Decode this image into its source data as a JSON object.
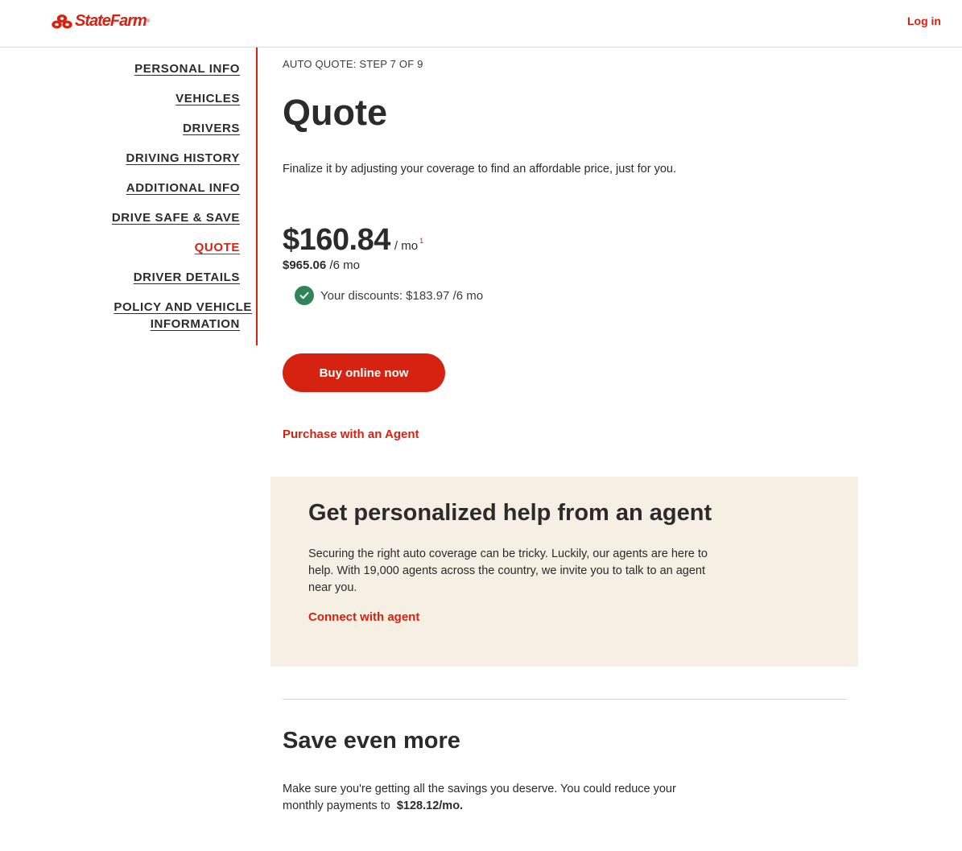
{
  "header": {
    "logo_text": "StateFarm",
    "logo_reg": "®",
    "login_label": "Log in"
  },
  "nav": {
    "items": [
      {
        "label": "PERSONAL INFO"
      },
      {
        "label": "VEHICLES"
      },
      {
        "label": "DRIVERS"
      },
      {
        "label": "DRIVING HISTORY"
      },
      {
        "label": "ADDITIONAL INFO"
      },
      {
        "label": "DRIVE SAFE & SAVE"
      },
      {
        "label": "QUOTE",
        "active": true
      },
      {
        "label": "DRIVER DETAILS"
      },
      {
        "label_line1": "POLICY AND VEHICLE",
        "label_line2": "INFORMATION"
      }
    ]
  },
  "main": {
    "step": "AUTO QUOTE: STEP 7 OF 9",
    "title": "Quote",
    "intro": "Finalize it by adjusting your coverage to find an affordable price, just for you.",
    "price": "$160.84",
    "per": "/ mo",
    "footnote": "1",
    "six_month_amount": "$965.06",
    "six_month_suffix": "/6 mo",
    "discounts": "Your discounts: $183.97 /6 mo",
    "buy_button": "Buy online now",
    "agent_link": "Purchase with an Agent"
  },
  "help": {
    "title": "Get personalized help from an agent",
    "text": "Securing the right auto coverage can be tricky. Luckily, our agents are here to help. With 19,000 agents across the country, we invite you to talk to an agent near you.",
    "link": "Connect with agent"
  },
  "save": {
    "title": "Save even more",
    "text": "Make sure you're getting all the savings you deserve. You could reduce your monthly payments to",
    "amount": "$128.12/mo."
  },
  "colors": {
    "brand_red": "#d62311",
    "help_bg": "#f6efe3",
    "check_green": "#2f8557"
  }
}
